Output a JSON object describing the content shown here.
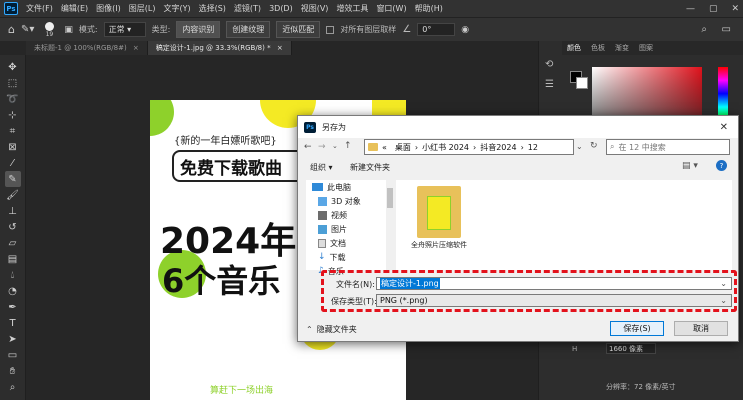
{
  "menubar": {
    "items": [
      "文件(F)",
      "编辑(E)",
      "图像(I)",
      "图层(L)",
      "文字(Y)",
      "选择(S)",
      "滤镜(T)",
      "3D(D)",
      "视图(V)",
      "增效工具",
      "窗口(W)",
      "帮助(H)"
    ],
    "ps_label": "Ps"
  },
  "options": {
    "brush_size": "19",
    "mode_label": "模式:",
    "mode_value": "正常",
    "type_label": "类型:",
    "type_buttons": [
      "内容识别",
      "创建纹理",
      "近似匹配"
    ],
    "sample_all_label": "对所有图层取样",
    "angle_symbol": "∠",
    "angle_value": "0°"
  },
  "tabs": [
    {
      "label": "未标题-1 @ 100%(RGB/8#)",
      "close": "×"
    },
    {
      "label": "稿定设计-1.jpg @ 33.3%(RGB/8) *",
      "close": "×"
    }
  ],
  "panel": {
    "tabs": [
      "颜色",
      "色板",
      "渐变",
      "图案"
    ],
    "h_label": "H",
    "h_value": "1660 像素",
    "resolution": "分辨率：72 像素/英寸"
  },
  "artwork": {
    "line1": "{新的一年白嫖听歌吧}",
    "line2": "免费下载歌曲",
    "line3": "2024年",
    "line4": "6个音乐",
    "footer": "算赶下一场出海"
  },
  "dialog": {
    "title": "另存为",
    "ps_label": "Ps",
    "close": "✕",
    "breadcrumb": [
      "«",
      "桌面",
      "小红书 2024",
      "抖音2024",
      "12"
    ],
    "search_placeholder": "在 12 中搜索",
    "organize": "组织 ▾",
    "new_folder": "新建文件夹",
    "nav_items": [
      {
        "label": "此电脑",
        "icon": "computer-icon"
      },
      {
        "label": "3D 对象",
        "icon": "cube-icon"
      },
      {
        "label": "视频",
        "icon": "video-icon"
      },
      {
        "label": "图片",
        "icon": "picture-icon"
      },
      {
        "label": "文档",
        "icon": "document-icon"
      },
      {
        "label": "下载",
        "icon": "download-icon"
      },
      {
        "label": "音乐",
        "icon": "music-icon"
      }
    ],
    "file_item": "全舟照片压缩软件",
    "filename_label": "文件名(N):",
    "filename_value": "稿定设计-1.png",
    "filetype_label": "保存类型(T):",
    "filetype_value": "PNG (*.png)",
    "hide_folders": "隐藏文件夹",
    "save": "保存(S)",
    "cancel": "取消"
  },
  "colors": {
    "highlight_red": "#e3121c",
    "accent_yellow": "#f4ea24",
    "accent_green": "#8ed12b",
    "selection_blue": "#0078d7"
  }
}
